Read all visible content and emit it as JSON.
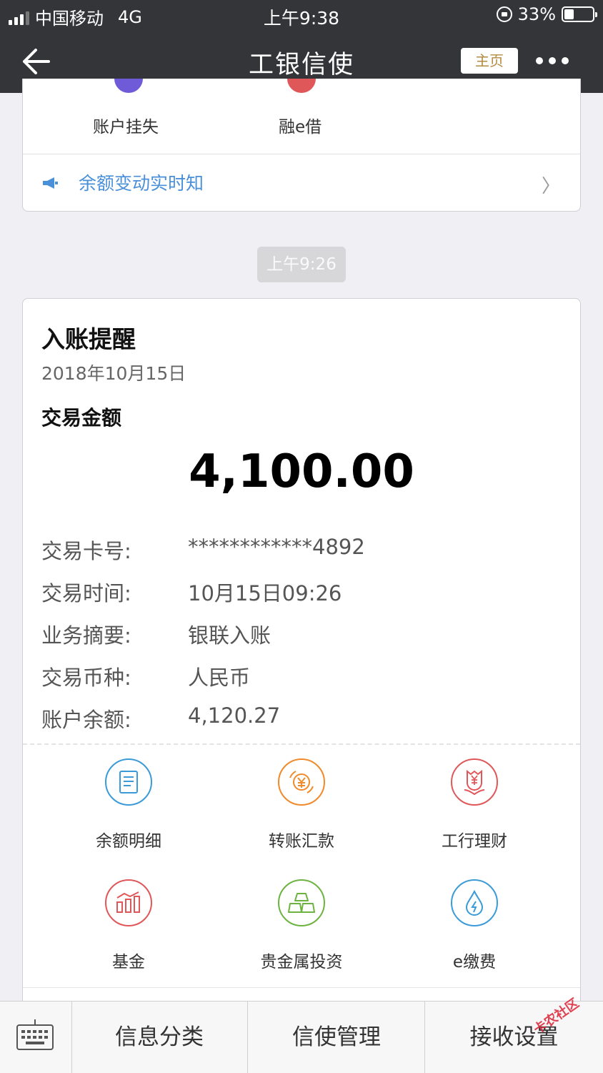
{
  "status": {
    "carrier": "中国移动",
    "network": "4G",
    "time": "上午9:38",
    "battery": "33%",
    "battery_level": 0.33
  },
  "nav": {
    "title": "工银信使",
    "home_label": "主页"
  },
  "card1": {
    "items": [
      {
        "label": "账户挂失"
      },
      {
        "label": "融e借"
      }
    ],
    "notice": "余额变动实时知"
  },
  "time_pill": "上午9:26",
  "message": {
    "title": "入账提醒",
    "date": "2018年10月15日",
    "amount_label": "交易金额",
    "amount": "4,100.00",
    "rows": [
      {
        "key": "交易卡号:",
        "value": "************4892"
      },
      {
        "key": "交易时间:",
        "value": "10月15日09:26"
      },
      {
        "key": "业务摘要:",
        "value": "银联入账"
      },
      {
        "key": "交易币种:",
        "value": "人民币"
      },
      {
        "key": "账户余额:",
        "value": "4,120.27"
      }
    ],
    "services": [
      {
        "label": "余额明细",
        "icon": "document-icon",
        "color": "#3b9bd8"
      },
      {
        "label": "转账汇款",
        "icon": "exchange-yuan-icon",
        "color": "#f08a2a"
      },
      {
        "label": "工行理财",
        "icon": "flower-yuan-icon",
        "color": "#e0575a"
      },
      {
        "label": "基金",
        "icon": "bar-chart-icon",
        "color": "#e0575a"
      },
      {
        "label": "贵金属投资",
        "icon": "gold-bars-icon",
        "color": "#6cb33f"
      },
      {
        "label": "e缴费",
        "icon": "water-drop-icon",
        "color": "#3b9bd8"
      }
    ]
  },
  "bottom_bar": {
    "tabs": [
      "信息分类",
      "信使管理",
      "接收设置"
    ]
  },
  "watermark": "卡农社区"
}
